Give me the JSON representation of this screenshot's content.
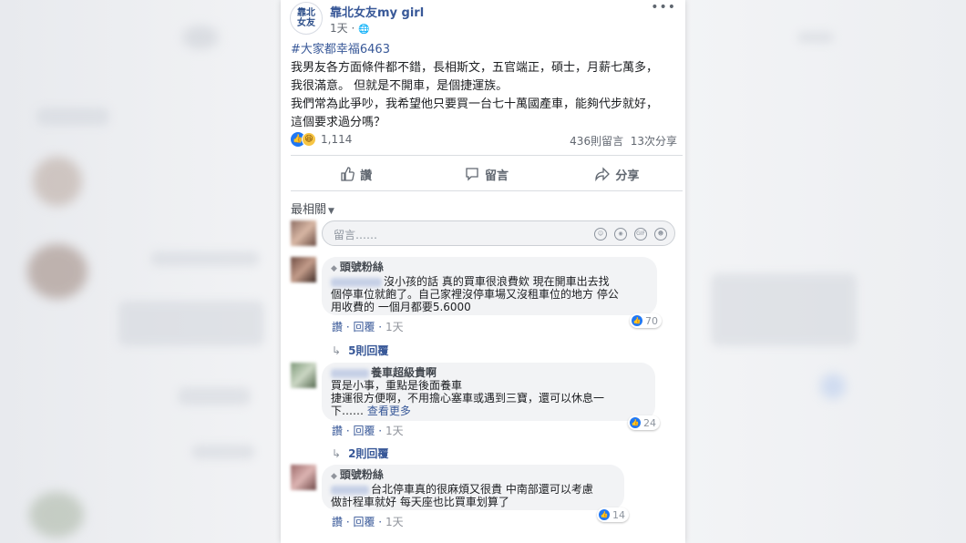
{
  "post": {
    "page_name": "靠北女友my girl",
    "logo_line1": "靠北",
    "logo_line2": "女友",
    "time": "1天 · ",
    "globe": "🌐",
    "more": "•••",
    "hashtag": "#大家都幸福6463",
    "body_lines": [
      "我男友各方面條件都不錯，長相斯文，五官端正，碩士，月薪七萬多，",
      "我很滿意。 但就是不開車，是個捷運族。",
      "我們常為此爭吵，我希望他只要買一台七十萬國產車，能夠代步就好，",
      "這個要求過分嗎？"
    ],
    "reaction_count": "1,114",
    "comments_count": "436則留言",
    "shares_count": "13次分享"
  },
  "actions": {
    "like": "讚",
    "comment": "留言",
    "share": "分享"
  },
  "sort_label": "最相關",
  "composer": {
    "placeholder": "留言……"
  },
  "comments": [
    {
      "badge": "頭號粉絲",
      "lines": [
        "沒小孩的話 真的買車很浪費欸 現在開車出去找",
        "個停車位就飽了。自己家裡沒停車場又沒租車位的地方 停公",
        "用收費的 一個月都要5.6000"
      ],
      "like": "讚",
      "reply": "回覆",
      "time": "1天",
      "reactions": "70",
      "replies": "5則回覆"
    },
    {
      "name_tail": "養車超級貴啊",
      "lines": [
        "買是小事，重點是後面養車",
        "捷運很方便啊，不用擔心塞車或遇到三寶，還可以休息一",
        "下……"
      ],
      "see_more": "查看更多",
      "like": "讚",
      "reply": "回覆",
      "time": "1天",
      "reactions": "24",
      "replies": "2則回覆"
    },
    {
      "badge": "頭號粉絲",
      "lines": [
        "台北停車真的很麻煩又很貴 中南部還可以考慮",
        "做計程車就好 每天座也比買車划算了"
      ],
      "like": "讚",
      "reply": "回覆",
      "time": "1天",
      "reactions": "14"
    }
  ],
  "colors": {
    "link": "#385898",
    "like_blue": "#2078f4",
    "bubble": "#f2f3f5"
  }
}
